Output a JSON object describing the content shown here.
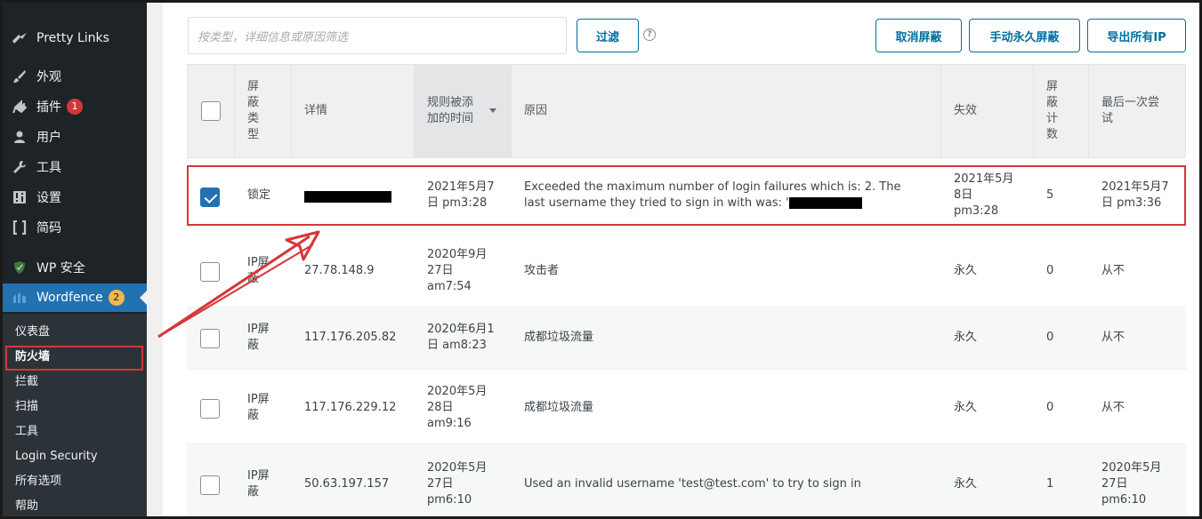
{
  "sidebar": {
    "top_items": [
      {
        "label": "Pretty Links",
        "icon": "pretty-links-icon"
      },
      {
        "label": "外观",
        "icon": "paintbrush-icon"
      },
      {
        "label": "插件",
        "icon": "plugin-icon",
        "badge": "1"
      },
      {
        "label": "用户",
        "icon": "user-icon"
      },
      {
        "label": "工具",
        "icon": "wrench-icon"
      },
      {
        "label": "设置",
        "icon": "settings-icon"
      },
      {
        "label": "简码",
        "icon": "shortcode-icon"
      },
      {
        "label": "WP 安全",
        "icon": "shield-icon"
      },
      {
        "label": "Wordfence",
        "icon": "wordfence-icon",
        "badge": "2"
      }
    ],
    "sub_items": [
      "仪表盘",
      "防火墙",
      "拦截",
      "扫描",
      "工具",
      "Login Security",
      "所有选项",
      "帮助"
    ]
  },
  "toolbar": {
    "filter_placeholder": "按类型，详细信息或原因筛选",
    "filter_button": "过滤",
    "help": "?",
    "unblock_button": "取消屏蔽",
    "make_permanent_button": "手动永久屏蔽",
    "export_button": "导出所有IP"
  },
  "table": {
    "headers": [
      "屏蔽类型",
      "详情",
      "规则被添加的时间",
      "原因",
      "失效",
      "屏蔽计数",
      "最后一次尝试"
    ],
    "rows": [
      {
        "checked": true,
        "type": "锁定",
        "detail": "",
        "added": "2021年5月7日 pm3:28",
        "reason": "Exceeded the maximum number of login failures which is: 2. The last username they tried to sign in with was: '",
        "expires": "2021年5月8日 pm3:28",
        "count": "5",
        "last": "2021年5月7日 pm3:36"
      },
      {
        "checked": false,
        "type": "IP屏蔽",
        "detail": "27.78.148.9",
        "added": "2020年9月27日 am7:54",
        "reason": "攻击者",
        "expires": "永久",
        "count": "0",
        "last": "从不"
      },
      {
        "checked": false,
        "type": "IP屏蔽",
        "detail": "117.176.205.82",
        "added": "2020年6月1日 am8:23",
        "reason": "成都垃圾流量",
        "expires": "永久",
        "count": "0",
        "last": "从不"
      },
      {
        "checked": false,
        "type": "IP屏蔽",
        "detail": "117.176.229.12",
        "added": "2020年5月28日 am9:16",
        "reason": "成都垃圾流量",
        "expires": "永久",
        "count": "0",
        "last": "从不"
      },
      {
        "checked": false,
        "type": "IP屏蔽",
        "detail": "50.63.197.157",
        "added": "2020年5月27日 pm6:10",
        "reason": "Used an invalid username 'test@test.com' to try to sign in",
        "expires": "永久",
        "count": "1",
        "last": "2020年5月27日 pm6:10"
      }
    ]
  },
  "colors": {
    "accent": "#2271b1",
    "highlight": "#d63638",
    "button": "#00709e"
  }
}
